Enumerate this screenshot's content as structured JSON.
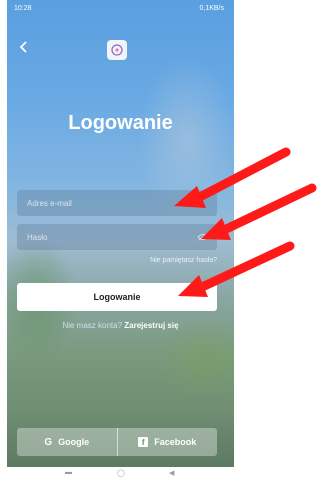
{
  "status_bar": {
    "time": "10:28",
    "right_info": "0,1KB/s",
    "icons": [
      "notification-icon",
      "wifi-icon",
      "signal-icon",
      "battery-icon"
    ]
  },
  "header": {
    "back_icon": "chevron-left-icon",
    "logo_icon": "app-logo-icon"
  },
  "page": {
    "title": "Logowanie"
  },
  "form": {
    "email_placeholder": "Adres e-mail",
    "password_placeholder": "Hasło",
    "eye_icon": "eye-icon",
    "forgot_password": "Nie pamiętasz hasła?",
    "login_button": "Logowanie"
  },
  "signup": {
    "prompt": "Nie masz konta?",
    "link": "Zarejestruj się"
  },
  "social": {
    "google_label": "Google",
    "google_icon": "G",
    "facebook_label": "Facebook",
    "facebook_icon": "f"
  },
  "colors": {
    "annotation_arrow": "#ff1a1a",
    "button_bg": "#ffffff"
  }
}
